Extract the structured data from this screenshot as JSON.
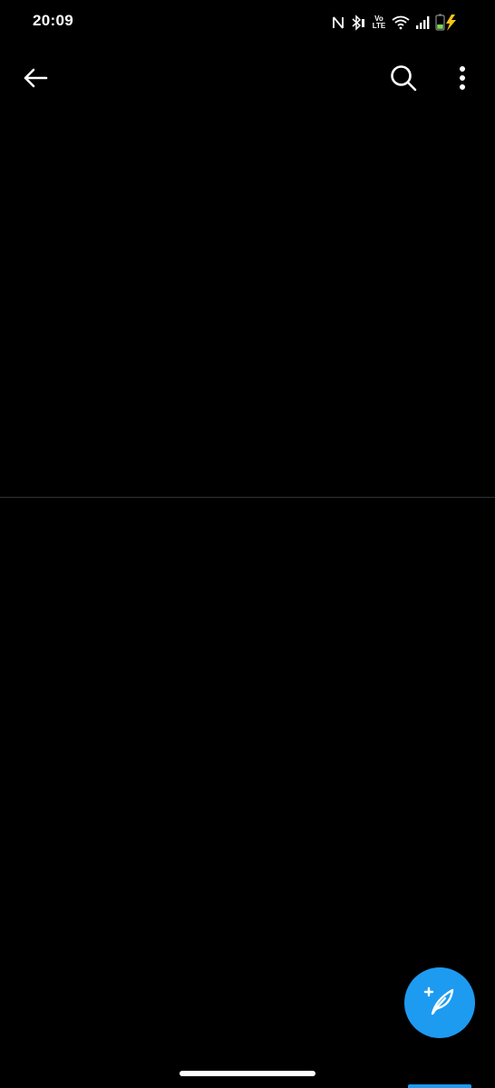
{
  "status_bar": {
    "time": "20:09",
    "volte_top": "Vo",
    "volte_bottom": "LTE",
    "icons": [
      "nfc-icon",
      "bluetooth-icon",
      "volte-icon",
      "wifi-icon",
      "signal-icon",
      "battery-charging-icon"
    ],
    "battery_level": 0.35,
    "battery_color": "#7ed957",
    "charging_bolt_color": "#f5c518"
  },
  "toolbar": {
    "icons": [
      "back-arrow-icon",
      "search-icon",
      "more-vertical-icon"
    ]
  },
  "fab": {
    "icon": "compose-tweet-icon",
    "color": "#1d9bf0"
  },
  "theme": {
    "background": "#000000",
    "divider": "#2f3336",
    "accent": "#1d9bf0"
  }
}
